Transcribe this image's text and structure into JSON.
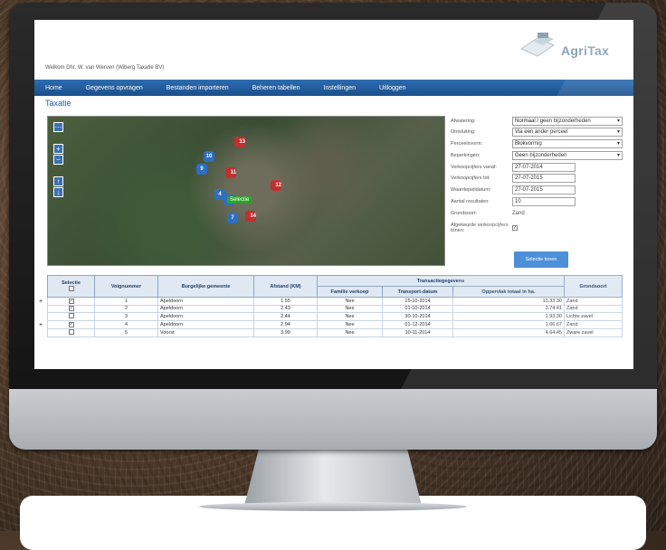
{
  "header": {
    "welcome": "Welkom Dhr. W. van Werven (Wiberg Taxatie BV)",
    "logo": "AgriTax"
  },
  "nav": {
    "items": [
      "Home",
      "Gegevens opvragen",
      "Bestanden importeren",
      "Beheren tabellen",
      "Instellingen",
      "Uitloggen"
    ]
  },
  "page": {
    "title": "Taxatie"
  },
  "map": {
    "select_label": "Selectie",
    "pins": [
      {
        "n": "13",
        "c": "r"
      },
      {
        "n": "10",
        "c": "b"
      },
      {
        "n": "9",
        "c": "b"
      },
      {
        "n": "11",
        "c": "r"
      },
      {
        "n": "12",
        "c": "r"
      },
      {
        "n": "4",
        "c": "b"
      },
      {
        "n": "5",
        "c": "b"
      },
      {
        "n": "7",
        "c": "b"
      },
      {
        "n": "14",
        "c": "r"
      }
    ]
  },
  "form": {
    "afwatering_label": "Afwatering:",
    "afwatering_value": "Normaal / geen bijzonderheden",
    "ontsluiting_label": "Ontsluiting:",
    "ontsluiting_value": "Via een ander perceel",
    "perceelsvorm_label": "Perceelsvorm:",
    "perceelsvorm_value": "Blokvormig",
    "beperkingen_label": "Beperkingen:",
    "beperkingen_value": "Geen bijzonderheden",
    "vanaf_label": "Verkoopcijfers vanaf:",
    "vanaf_value": "27-07-2014",
    "tot_label": "Verkoopcijfers tot:",
    "tot_value": "27-07-2015",
    "peildatum_label": "Waardepeildatum:",
    "peildatum_value": "27-07-2015",
    "aantal_label": "Aantal resultaten:",
    "aantal_value": "10",
    "grondsoort_label": "Grondsoort:",
    "grondsoort_value": "Zand",
    "afgekeurde_label": "Afgekeurde verkoopcijfers tonen:",
    "button": "Selectie tonen"
  },
  "table": {
    "headers": {
      "selectie": "Selectie",
      "volgnummer": "Volgnummer",
      "gemeente": "Burgelijke gemeente",
      "afstand": "Afstand (KM)",
      "transactie": "Transactiegegevens",
      "familie": "Familie verkoop",
      "datum": "Transport-datum",
      "oppervlak": "Oppervlak totaal in ha.",
      "grondsoort": "Grondsoort"
    },
    "rows": [
      {
        "checked": true,
        "nr": "1",
        "gemeente": "Apeldoorn",
        "afstand": "1.55",
        "familie": "Nee",
        "datum": "15-10-2014",
        "opp": "13.33.30",
        "grond": "Zand",
        "plus": true
      },
      {
        "checked": true,
        "nr": "2",
        "gemeente": "Apeldoorn",
        "afstand": "2.43",
        "familie": "Nee",
        "datum": "01-10-2014",
        "opp": "3.74.41",
        "grond": "Zand",
        "plus": false
      },
      {
        "checked": false,
        "nr": "3",
        "gemeente": "Apeldoorn",
        "afstand": "2.44",
        "familie": "Nee",
        "datum": "30-10-2014",
        "opp": "1.93.30",
        "grond": "Lichte zavel",
        "plus": false
      },
      {
        "checked": true,
        "nr": "4",
        "gemeente": "Apeldoorn",
        "afstand": "2.94",
        "familie": "Nee",
        "datum": "01-12-2014",
        "opp": "1.06.67",
        "grond": "Zand",
        "plus": true
      },
      {
        "checked": false,
        "nr": "5",
        "gemeente": "Voorst",
        "afstand": "3.99",
        "familie": "Nee",
        "datum": "10-11-2014",
        "opp": "4.64.45",
        "grond": "Zware zavel",
        "plus": false
      }
    ]
  }
}
